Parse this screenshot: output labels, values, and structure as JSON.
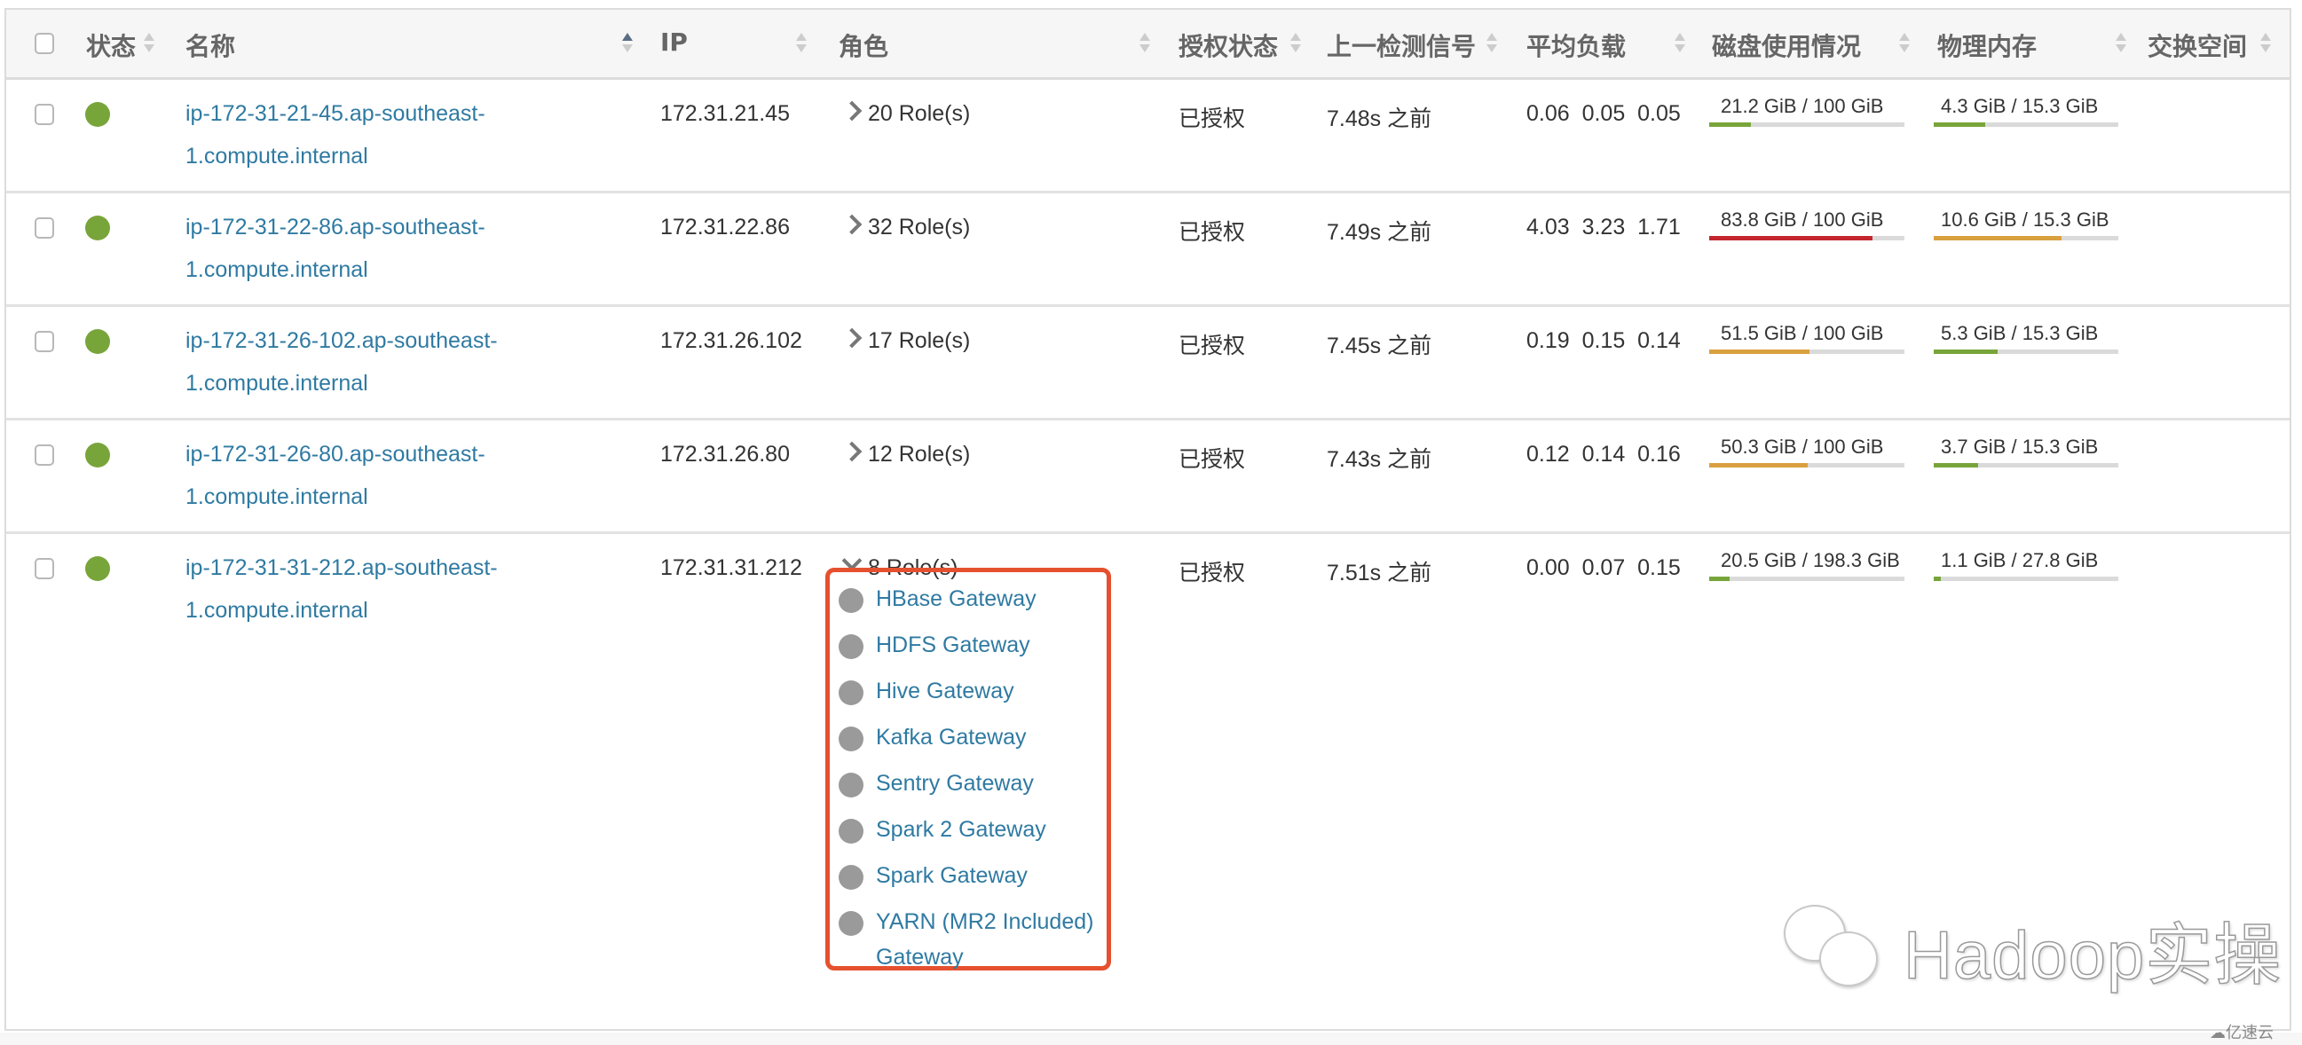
{
  "table": {
    "columns": [
      {
        "label": "状态",
        "sortable": true,
        "active": false
      },
      {
        "label": "名称",
        "sortable": true,
        "active": true,
        "direction": "asc"
      },
      {
        "label": "IP",
        "sortable": true,
        "active": false
      },
      {
        "label": "角色",
        "sortable": true,
        "active": false
      },
      {
        "label": "授权状态",
        "sortable": true,
        "active": false
      },
      {
        "label": "上一检测信号",
        "sortable": true,
        "active": false
      },
      {
        "label": "平均负载",
        "sortable": true,
        "active": false
      },
      {
        "label": "磁盘使用情况",
        "sortable": true,
        "active": false
      },
      {
        "label": "物理内存",
        "sortable": true,
        "active": false
      },
      {
        "label": "交换空间",
        "sortable": true,
        "active": false
      }
    ],
    "rows": [
      {
        "status": "good",
        "name_line1": "ip-172-31-21-45.ap-southeast-",
        "name_line2": "1.compute.internal",
        "ip": "172.31.21.45",
        "roles": "20 Role(s)",
        "roles_expanded": false,
        "auth": "已授权",
        "heartbeat": "7.48s 之前",
        "load": [
          "0.06",
          "0.05",
          "0.05"
        ],
        "disk": {
          "label": "21.2 GiB / 100 GiB",
          "fraction": 0.212,
          "color": "#78a53a"
        },
        "memory": {
          "label": "4.3 GiB / 15.3 GiB",
          "fraction": 0.281,
          "color": "#78a53a"
        },
        "swap": ""
      },
      {
        "status": "good",
        "name_line1": "ip-172-31-22-86.ap-southeast-",
        "name_line2": "1.compute.internal",
        "ip": "172.31.22.86",
        "roles": "32 Role(s)",
        "roles_expanded": false,
        "auth": "已授权",
        "heartbeat": "7.49s 之前",
        "load": [
          "4.03",
          "3.23",
          "1.71"
        ],
        "disk": {
          "label": "83.8 GiB / 100 GiB",
          "fraction": 0.838,
          "color": "#c3262d"
        },
        "memory": {
          "label": "10.6 GiB / 15.3 GiB",
          "fraction": 0.693,
          "color": "#d9a03f"
        },
        "swap": ""
      },
      {
        "status": "good",
        "name_line1": "ip-172-31-26-102.ap-southeast-",
        "name_line2": "1.compute.internal",
        "ip": "172.31.26.102",
        "roles": "17 Role(s)",
        "roles_expanded": false,
        "auth": "已授权",
        "heartbeat": "7.45s 之前",
        "load": [
          "0.19",
          "0.15",
          "0.14"
        ],
        "disk": {
          "label": "51.5 GiB / 100 GiB",
          "fraction": 0.515,
          "color": "#d9a03f"
        },
        "memory": {
          "label": "5.3 GiB / 15.3 GiB",
          "fraction": 0.346,
          "color": "#78a53a"
        },
        "swap": ""
      },
      {
        "status": "good",
        "name_line1": "ip-172-31-26-80.ap-southeast-",
        "name_line2": "1.compute.internal",
        "ip": "172.31.26.80",
        "roles": "12 Role(s)",
        "roles_expanded": false,
        "auth": "已授权",
        "heartbeat": "7.43s 之前",
        "load": [
          "0.12",
          "0.14",
          "0.16"
        ],
        "disk": {
          "label": "50.3 GiB / 100 GiB",
          "fraction": 0.503,
          "color": "#d9a03f"
        },
        "memory": {
          "label": "3.7 GiB / 15.3 GiB",
          "fraction": 0.242,
          "color": "#78a53a"
        },
        "swap": ""
      },
      {
        "status": "good",
        "name_line1": "ip-172-31-31-212.ap-southeast-",
        "name_line2": "1.compute.internal",
        "ip": "172.31.31.212",
        "roles": "8 Role(s)",
        "roles_expanded": true,
        "auth": "已授权",
        "heartbeat": "7.51s 之前",
        "load": [
          "0.00",
          "0.07",
          "0.15"
        ],
        "disk": {
          "label": "20.5 GiB / 198.3 GiB",
          "fraction": 0.103,
          "color": "#78a53a"
        },
        "memory": {
          "label": "1.1 GiB / 27.8 GiB",
          "fraction": 0.04,
          "color": "#78a53a"
        },
        "swap": "",
        "role_list": [
          "HBase Gateway",
          "HDFS Gateway",
          "Hive Gateway",
          "Kafka Gateway",
          "Sentry Gateway",
          "Spark 2 Gateway",
          "Spark Gateway",
          "YARN (MR2 Included) Gateway"
        ]
      }
    ]
  },
  "colors": {
    "status_good": "#78a53a",
    "link": "#2f7aa2",
    "highlight_box": "#e5512f",
    "role_dot": "#9a9a9a"
  },
  "watermark": {
    "text": "Hadoop实操",
    "icon": "wechat-icon"
  },
  "corner_brand": {
    "text": "亿速云",
    "icon": "cloud-logo-icon"
  }
}
